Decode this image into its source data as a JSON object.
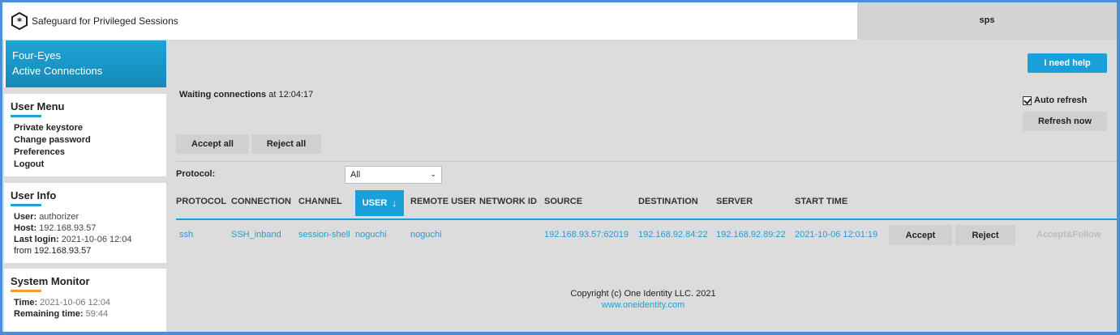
{
  "header": {
    "app_title": "Safeguard for Privileged Sessions",
    "hostname": "sps"
  },
  "sidebar": {
    "active_nav": {
      "line1": "Four-Eyes",
      "line2": "Active Connections"
    },
    "user_menu": {
      "title": "User Menu",
      "items": [
        "Private keystore",
        "Change password",
        "Preferences",
        "Logout"
      ]
    },
    "user_info": {
      "title": "User Info",
      "user_label": "User:",
      "user_value": "authorizer",
      "host_label": "Host:",
      "host_value": "192.168.93.57",
      "last_login_label": "Last login:",
      "last_login_value": "2021-10-06 12:04",
      "from_text": "from 192.168.93.57"
    },
    "system_monitor": {
      "title": "System Monitor",
      "time_label": "Time:",
      "time_value": "2021-10-06 12:04",
      "remaining_label": "Remaining time:",
      "remaining_value": "59:44"
    }
  },
  "main": {
    "help_button": "I need help",
    "waiting_label": "Waiting connections",
    "waiting_suffix": "at 12:04:17",
    "auto_refresh_label": "Auto refresh",
    "auto_refresh_checked": true,
    "refresh_now": "Refresh now",
    "accept_all": "Accept all",
    "reject_all": "Reject all",
    "protocol_label": "Protocol:",
    "protocol_selected": "All",
    "columns": [
      "PROTOCOL",
      "CONNECTION",
      "CHANNEL",
      "USER",
      "REMOTE USER",
      "NETWORK ID",
      "SOURCE",
      "DESTINATION",
      "SERVER",
      "START TIME"
    ],
    "sort_icon": "↓",
    "rows": [
      {
        "protocol": "ssh",
        "connection": "SSH_inband",
        "channel": "session-shell",
        "user": "noguchi",
        "remote_user": "noguchi",
        "network_id": "",
        "source": "192.168.93.57:62019",
        "destination": "192.168.92.84:22",
        "server": "192.168.92.89:22",
        "start_time": "2021-10-06 12:01:19",
        "accept": "Accept",
        "reject": "Reject",
        "accept_follow": "Accept&Follow"
      }
    ]
  },
  "footer": {
    "copyright": "Copyright (c) One Identity LLC. 2021",
    "link": "www.oneidentity.com"
  },
  "colors": {
    "accent": "#1aa0d8",
    "user_menu_underline": "#1fa3d6",
    "system_monitor_underline": "#f0a030"
  }
}
